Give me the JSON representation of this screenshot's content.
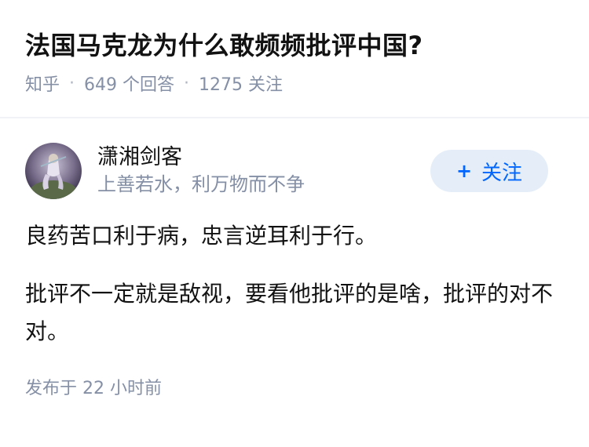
{
  "question": {
    "title": "法国马克龙为什么敢频频批评中国?",
    "source": "知乎",
    "answer_count": "649 个回答",
    "follower_count": "1275 关注"
  },
  "answer": {
    "author_name": "潇湘剑客",
    "author_bio": "上善若水，利万物而不争",
    "follow_label": "关注",
    "paragraphs": [
      "良药苦口利于病，忠言逆耳利于行。",
      "批评不一定就是敌视，要看他批评的是啥，批评的对不对。"
    ],
    "published": "发布于 22 小时前"
  },
  "colors": {
    "accent": "#0066ff",
    "muted": "#8590a6",
    "button_bg": "#e5eef8"
  },
  "icons": {
    "follow": "plus-icon"
  }
}
